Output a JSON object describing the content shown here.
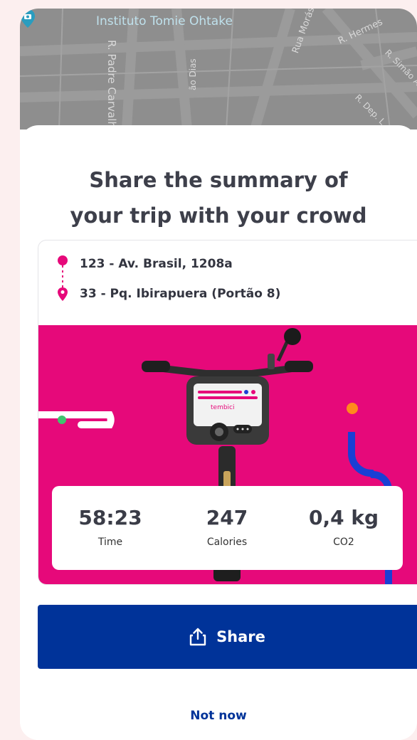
{
  "map": {
    "poi_name": "Instituto Tomie Ohtake",
    "streets": [
      "R. Padre Carvalho",
      "Rua Morás",
      "R. Hermes",
      "R. Simão Álvares",
      "R. Dep. L",
      "ão Dias"
    ]
  },
  "sheet": {
    "title_line1": "Share the summary of",
    "title_line2": "your trip with your crowd"
  },
  "route": {
    "origin": "123 - Av. Brasil, 1208a",
    "destination": "33 - Pq. Ibirapuera (Portão 8)"
  },
  "hero": {
    "brand_on_bike": "tembici",
    "background_color": "#e6097a"
  },
  "stats": [
    {
      "value": "58:23",
      "label": "Time"
    },
    {
      "value": "247",
      "label": "Calories"
    },
    {
      "value": "0,4 kg",
      "label": "CO2"
    }
  ],
  "actions": {
    "share_label": "Share",
    "share_icon": "share-icon",
    "dismiss_label": "Not now"
  },
  "colors": {
    "primary": "#003399",
    "accent_pink": "#e6097a",
    "page_background": "#fcefef"
  }
}
